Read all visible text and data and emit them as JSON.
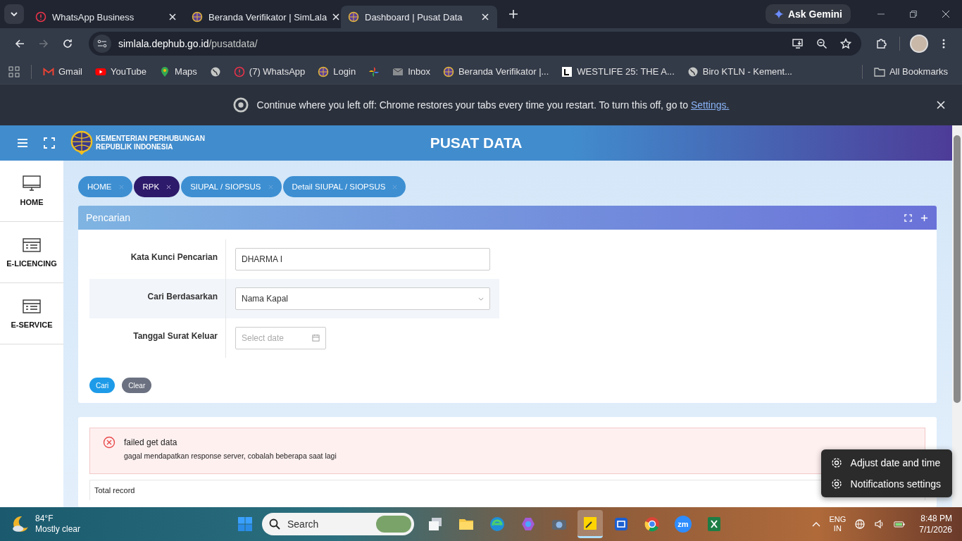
{
  "browser": {
    "tabs": [
      {
        "title": "WhatsApp Business",
        "kind": "alert",
        "selected": false
      },
      {
        "title": "Beranda Verifikator | SimLala",
        "kind": "emblem",
        "selected": false
      },
      {
        "title": "Dashboard | Pusat Data",
        "kind": "emblem",
        "selected": true
      }
    ],
    "gemini": "Ask Gemini",
    "url_host": "simlala.dephub.go.id",
    "url_path": "/pusatdata/",
    "bookmarks": [
      {
        "label": "Gmail",
        "kind": "gmail"
      },
      {
        "label": "YouTube",
        "kind": "youtube"
      },
      {
        "label": "Maps",
        "kind": "maps"
      },
      {
        "kind": "globe"
      },
      {
        "label": "(7) WhatsApp",
        "kind": "alert"
      },
      {
        "label": "Login",
        "kind": "emblem"
      },
      {
        "kind": "pinwheel"
      },
      {
        "label": "Inbox",
        "kind": "mail"
      },
      {
        "label": "Beranda Verifikator |...",
        "kind": "emblem"
      },
      {
        "label": "WESTLIFE 25: THE A...",
        "kind": "square"
      },
      {
        "label": "Biro KTLN - Kement...",
        "kind": "globe"
      }
    ],
    "all_bookmarks": "All Bookmarks"
  },
  "infobar": {
    "text": "Continue where you left off: Chrome restores your tabs every time you restart. To turn this off, go to",
    "link": "Settings."
  },
  "header": {
    "logo_line1": "KEMENTERIAN PERHUBUNGAN",
    "logo_line2": "REPUBLIK INDONESIA",
    "title": "PUSAT DATA"
  },
  "sidebar": [
    {
      "label": "HOME",
      "kind": "monitor"
    },
    {
      "label": "E-LICENCING",
      "kind": "card"
    },
    {
      "label": "E-SERVICE",
      "kind": "card"
    }
  ],
  "breadcrumbs": [
    {
      "label": "HOME",
      "selected": false
    },
    {
      "label": "RPK",
      "selected": true
    },
    {
      "label": "SIUPAL / SIOPSUS",
      "selected": false
    },
    {
      "label": "Detail SIUPAL / SIOPSUS",
      "selected": false
    }
  ],
  "search_panel": {
    "title": "Pencarian",
    "fields": [
      {
        "label": "Kata Kunci Pencarian",
        "kind": "text",
        "value": "DHARMA I"
      },
      {
        "label": "Cari Berdasarkan",
        "kind": "select",
        "value": "Nama Kapal"
      },
      {
        "label": "Tanggal Surat Keluar",
        "kind": "date",
        "placeholder": "Select date"
      }
    ],
    "buttons": [
      {
        "label": "Cari",
        "kind": "primary"
      },
      {
        "label": "Clear",
        "kind": "secondary"
      }
    ]
  },
  "alert": {
    "title": "failed get data",
    "message": "gagal mendapatkan response server, cobalah beberapa saat lagi"
  },
  "total_record": "Total record",
  "context_menu": [
    "Adjust date and time",
    "Notifications settings"
  ],
  "taskbar": {
    "weather_temp": "84°F",
    "weather_text": "Mostly clear",
    "search_placeholder": "Search",
    "apps": [
      {
        "kind": "taskview"
      },
      {
        "kind": "folder"
      },
      {
        "kind": "edge"
      },
      {
        "kind": "copilot"
      },
      {
        "kind": "camera"
      },
      {
        "kind": "sticky",
        "selected": true
      },
      {
        "kind": "screen"
      },
      {
        "kind": "chrome"
      },
      {
        "kind": "zoom",
        "text": "zm"
      },
      {
        "kind": "excel"
      }
    ],
    "lang": "ENG",
    "region": "IN",
    "time": "8:48 PM",
    "date": "7/1/2026"
  }
}
